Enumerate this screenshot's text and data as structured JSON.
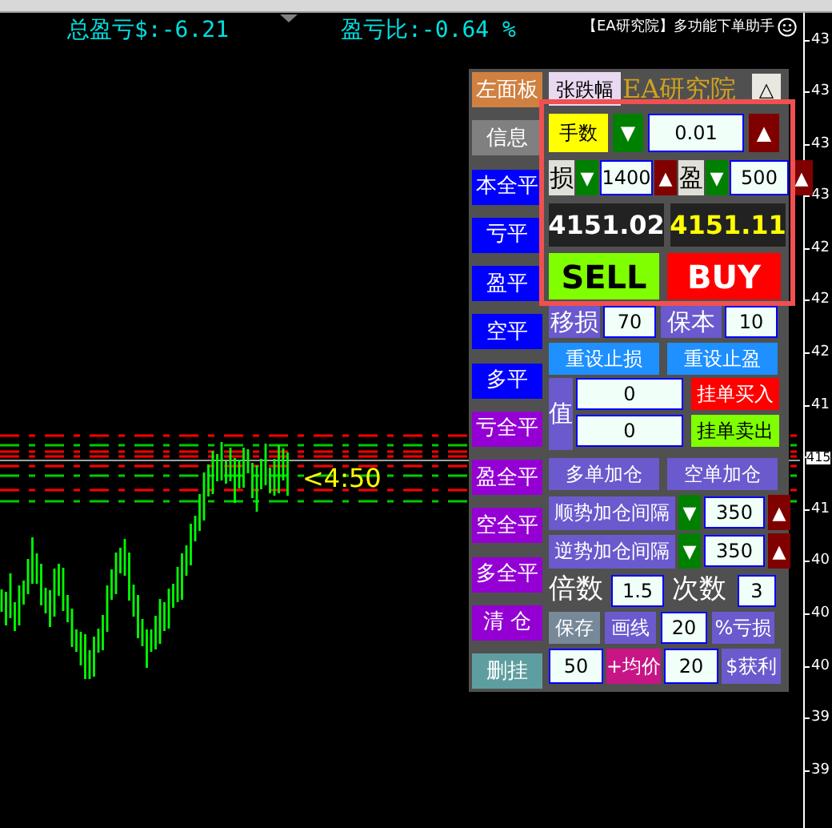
{
  "header": {
    "total_pl": "总盈亏$:-6.21",
    "pl_ratio": "盈亏比:-0.64 %",
    "title": "【EA研究院】多功能下单助手"
  },
  "chart": {
    "countdown": "<4:50",
    "price_labels": [
      {
        "text": "43",
        "current": false
      },
      {
        "text": "43",
        "current": false
      },
      {
        "text": "43",
        "current": false
      },
      {
        "text": "43",
        "current": false
      },
      {
        "text": "42",
        "current": false
      },
      {
        "text": "42",
        "current": false
      },
      {
        "text": "42",
        "current": false
      },
      {
        "text": "41",
        "current": false
      },
      {
        "text": "415",
        "current": true
      },
      {
        "text": "41",
        "current": false
      },
      {
        "text": "40",
        "current": false
      },
      {
        "text": "40",
        "current": false
      },
      {
        "text": "40",
        "current": false
      },
      {
        "text": "39",
        "current": false
      },
      {
        "text": "39",
        "current": false
      }
    ]
  },
  "panel": {
    "left_buttons": [
      {
        "label": "左面板",
        "color": "#d08040"
      },
      {
        "label": "信息",
        "color": "#808080"
      },
      {
        "label": "本全平",
        "color": "#0000ff"
      },
      {
        "label": "亏平",
        "color": "#0000ff"
      },
      {
        "label": "盈平",
        "color": "#0000ff"
      },
      {
        "label": "空平",
        "color": "#0000ff"
      },
      {
        "label": "多平",
        "color": "#0000ff"
      },
      {
        "label": "亏全平",
        "color": "#9400d3"
      },
      {
        "label": "盈全平",
        "color": "#9400d3"
      },
      {
        "label": "空全平",
        "color": "#9400d3"
      },
      {
        "label": "多全平",
        "color": "#9400d3"
      },
      {
        "label": "清 仓",
        "color": "#9400d3"
      },
      {
        "label": "删挂",
        "color": "#5f9ea0"
      }
    ],
    "range_button": "张跌幅",
    "brand": "EA研究院",
    "collapse_button": "△",
    "lots": {
      "label": "手数",
      "down": "▼",
      "value": "0.01",
      "up": "▲"
    },
    "sl": {
      "label": "损",
      "down": "▼",
      "value": "1400",
      "up": "▲"
    },
    "tp": {
      "label": "盈",
      "down": "▼",
      "value": "500",
      "up": "▲"
    },
    "bid": "4151.02",
    "ask": "4151.11",
    "sell": "SELL",
    "buy": "BUY",
    "trail": {
      "label": "移损",
      "value": "70"
    },
    "breakeven": {
      "label": "保本",
      "value": "10"
    },
    "reset_sl": "重设止损",
    "reset_tp": "重设止盈",
    "pending": {
      "label": "值",
      "buy_value": "0",
      "sell_value": "0",
      "buy_button": "挂单买入",
      "sell_button": "挂单卖出"
    },
    "add_long": "多单加仓",
    "add_short": "空单加仓",
    "spacing_rows": [
      {
        "label": "顺势加仓间隔",
        "down": "▼",
        "value": "350",
        "up": "▲"
      },
      {
        "label": "逆势加仓间隔",
        "down": "▼",
        "value": "350",
        "up": "▲"
      }
    ],
    "multiplier": {
      "label": "倍数",
      "value": "1.5"
    },
    "times": {
      "label": "次数",
      "value": "3"
    },
    "save": "保存",
    "draw_line": "画线",
    "loss_value": "20",
    "loss_pct": "%亏损",
    "avg_value": "50",
    "avg_button": "+均价",
    "profit_value": "20",
    "profit_button": "$获利"
  }
}
